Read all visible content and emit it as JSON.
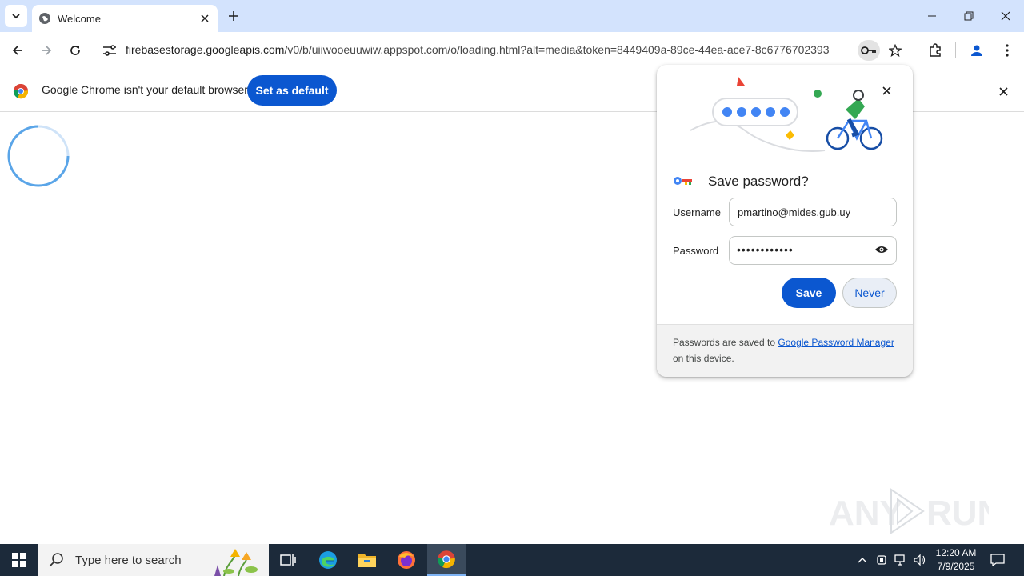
{
  "tab": {
    "title": "Welcome"
  },
  "address": {
    "host": "firebasestorage.googleapis.com",
    "path": "/v0/b/uiiwooeuuwiw.appspot.com/o/loading.html?alt=media&token=8449409a-89ce-44ea-ace7-8c6776702393"
  },
  "infobar": {
    "message": "Google Chrome isn't your default browser",
    "button_label": "Set as default"
  },
  "password_bubble": {
    "title": "Save password?",
    "username_label": "Username",
    "username_value": "pmartino@mides.gub.uy",
    "password_label": "Password",
    "password_masked": "••••••••••••",
    "save_label": "Save",
    "never_label": "Never",
    "footer_prefix": "Passwords are saved to ",
    "footer_link": "Google Password Manager",
    "footer_suffix": " on this device."
  },
  "taskbar": {
    "search_placeholder": "Type here to search",
    "time": "12:20 AM",
    "date": "7/9/2025"
  },
  "watermark": {
    "text": "ANY RUN"
  },
  "colors": {
    "accent": "#0b57d0",
    "tabstrip": "#d3e3fd",
    "taskbar": "#1c2a3a"
  }
}
